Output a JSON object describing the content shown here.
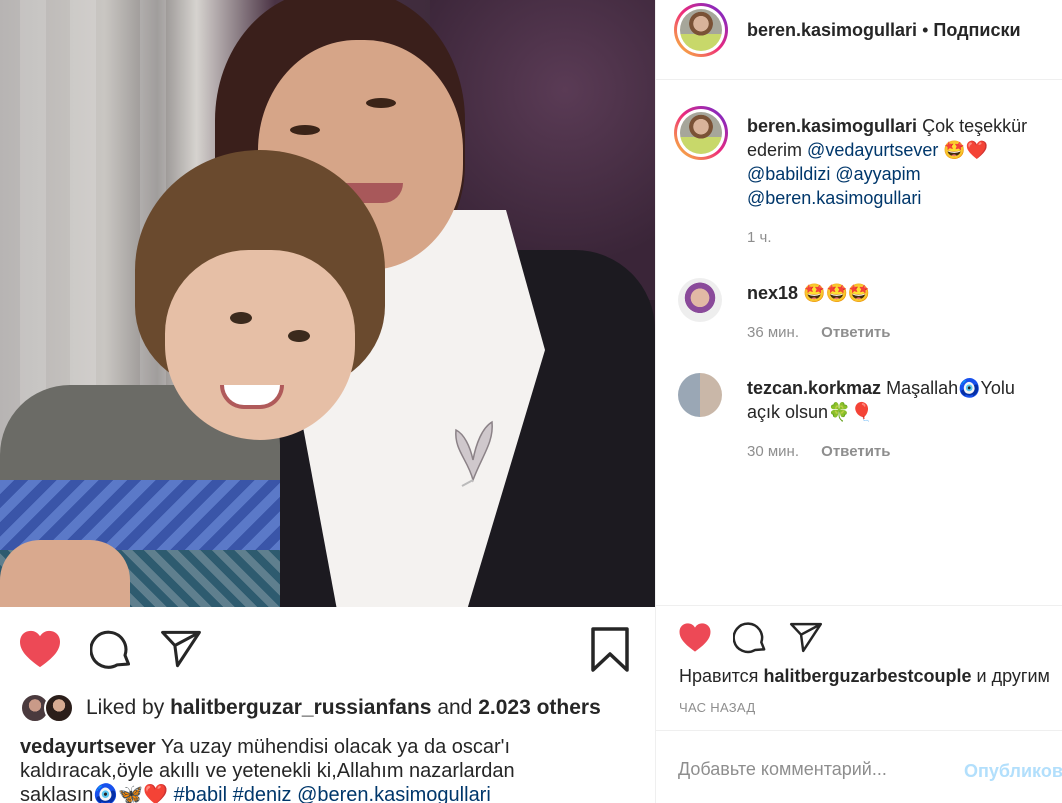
{
  "post": {
    "owner": "beren.kasimogullari",
    "follow_label": "Подписки",
    "separator": "•"
  },
  "caption_comment": {
    "username": "beren.kasimogullari",
    "text": "Çok teşekkür ederim",
    "mentions": "@vedayurtsever",
    "emojis": "🤩❤️",
    "tags_line2": "@babildizi @ayyapim",
    "tags_line3": "@beren.kasimogullari",
    "time": "1 ч."
  },
  "comments": [
    {
      "username": "nex18",
      "text": "🤩🤩🤩",
      "time": "36 мин.",
      "reply_label": "Ответить"
    },
    {
      "username": "tezcan.korkmaz",
      "text": "Maşallah🧿Yolu açık olsun🍀🎈",
      "time": "30 мин.",
      "reply_label": "Ответить"
    }
  ],
  "right_footer": {
    "likes_prefix": "Нравится",
    "likes_user": "halitberguzarbestcouple",
    "likes_suffix": "и другим",
    "time_ago": "ЧАС НАЗАД",
    "comment_placeholder": "Добавьте комментарий...",
    "post_label": "Опубликовать"
  },
  "left_footer": {
    "liked_by_prefix": "Liked by",
    "liked_by_user": "halitberguzar_russianfans",
    "liked_by_and": "and",
    "liked_by_count": "2.023 others",
    "caption_user": "vedayurtsever",
    "caption_line1": "Ya uzay mühendisi olacak ya da oscar'ı",
    "caption_line2": "kaldıracak,öyle akıllı ve yetenekli ki,Allahım nazarlardan",
    "caption_line3_text": "saklasın🧿🦋❤️",
    "caption_line3_tags": "#babil #deniz @beren.kasimogullari"
  },
  "icons": {
    "like": "heart-icon",
    "comment": "comment-bubble-icon",
    "share": "paper-plane-icon",
    "save": "bookmark-icon"
  },
  "colors": {
    "like_red": "#ed4956",
    "link_blue": "#00376b",
    "muted_gray": "#8e8e8e",
    "post_button_disabled": "#b2dffc"
  }
}
